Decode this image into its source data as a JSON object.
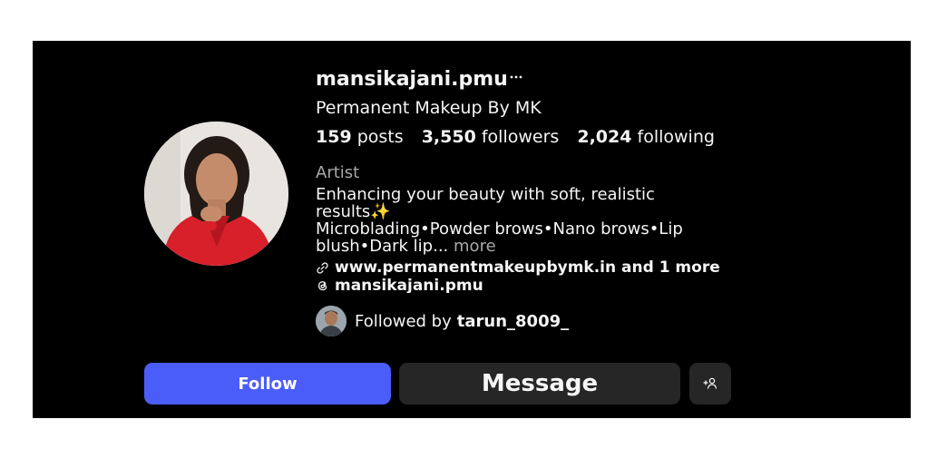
{
  "profile": {
    "username": "mansikajani.pmu",
    "options_icon": "ellipsis-icon",
    "full_name": "Permanent Makeup By MK",
    "stats": {
      "posts_count": "159",
      "posts_label": "posts",
      "followers_count": "3,550",
      "followers_label": "followers",
      "following_count": "2,024",
      "following_label": "following"
    },
    "category": "Artist",
    "bio_line1": "Enhancing your beauty with soft, realistic results✨",
    "bio_line2": "Microblading•Powder brows•Nano brows•Lip blush•Dark lip...",
    "bio_more": "more",
    "link_icon": "link-icon",
    "link_text": "www.permanentmakeupbymk.in and 1 more",
    "threads_icon": "threads-icon",
    "threads_handle": "mansikajani.pmu",
    "followed_by_label": "Followed by",
    "followed_by_user": "tarun_8009_"
  },
  "actions": {
    "follow_label": "Follow",
    "message_label": "Message",
    "suggest_icon": "add-person-icon"
  },
  "colors": {
    "background": "#000000",
    "page": "#ffffff",
    "follow_button": "#4a5df9",
    "secondary_button": "#262626",
    "muted_text": "#a8a8a8",
    "primary_text": "#f5f5f5"
  }
}
